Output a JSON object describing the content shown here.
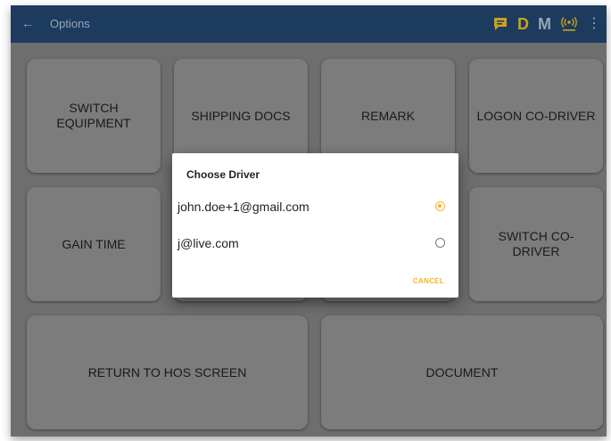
{
  "app_bar": {
    "back_icon": "back-arrow-icon",
    "title": "Options",
    "status_icons": {
      "message": "message-icon",
      "driver_letter": "D",
      "mode_letter": "M",
      "signal": "signal-broadcast-icon",
      "menu": "more-vert-icon"
    },
    "colors": {
      "bar": "#1c3b5e",
      "text": "#9aa6b3",
      "accent": "#c8a21d"
    }
  },
  "tiles": {
    "switch_equipment": "SWITCH EQUIPMENT",
    "shipping_docs": "SHIPPING DOCS",
    "remark": "REMARK",
    "logon_co_driver": "LOGON CO-DRIVER",
    "gain_time": "GAIN TIME",
    "switch_co_driver": "SWITCH CO-DRIVER",
    "return_to_hos": "RETURN TO HOS SCREEN",
    "document": "DOCUMENT"
  },
  "dialog": {
    "title": "Choose Driver",
    "options": [
      {
        "label": "john.doe+1@gmail.com",
        "selected": true
      },
      {
        "label": "j@live.com",
        "selected": false
      }
    ],
    "cancel_label": "CANCEL",
    "accent_color": "#f2b51d"
  }
}
